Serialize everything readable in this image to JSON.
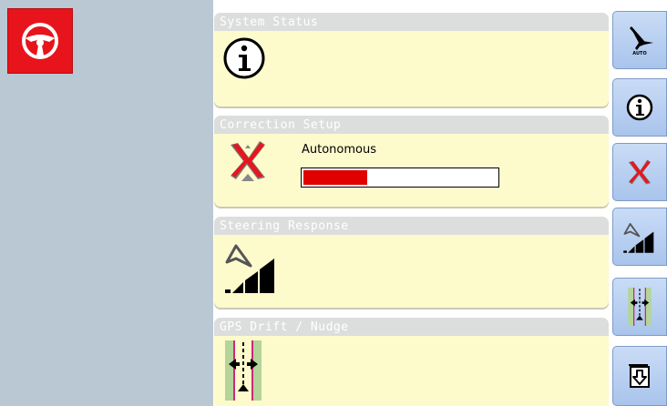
{
  "cards": {
    "status": {
      "title": "System Status"
    },
    "correction": {
      "title": "Correction Setup",
      "label": "Autonomous",
      "progress": 0.33
    },
    "steering": {
      "title": "Steering Response"
    },
    "gps": {
      "title": "GPS Drift / Nudge"
    }
  },
  "sidebar": {
    "buttons": [
      {
        "icon": "autosteer-icon",
        "label": "AUTO"
      },
      {
        "icon": "info-icon"
      },
      {
        "icon": "correction-off-icon"
      },
      {
        "icon": "steering-response-icon"
      },
      {
        "icon": "gps-nudge-icon"
      },
      {
        "icon": "download-icon"
      }
    ]
  },
  "colors": {
    "left_panel": "#b9c8d3",
    "card_bg": "#fdfacc",
    "card_title_bg": "#dcdedd",
    "steer_button": "#e8141b",
    "progress_fill": "#e00000",
    "side_button": "#b9d0f0"
  }
}
